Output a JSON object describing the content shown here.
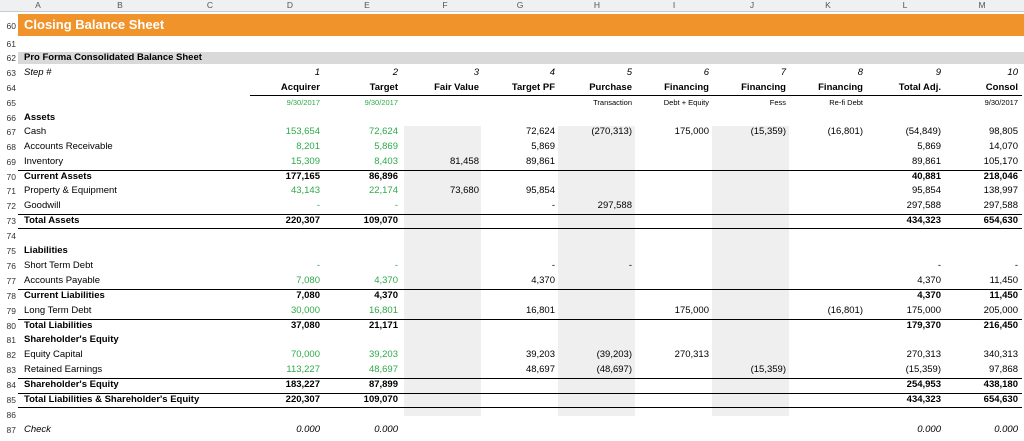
{
  "column_letters": [
    "A",
    "B",
    "C",
    "D",
    "E",
    "F",
    "G",
    "H",
    "I",
    "J",
    "K",
    "L",
    "M"
  ],
  "banner": {
    "title": "Closing Balance Sheet",
    "color": "#f0932b"
  },
  "colors": {
    "input_green": "#2eaa4a",
    "shade_grey": "#efefef",
    "section_band": "#d9d9d9"
  },
  "rows": [
    {
      "n": "60",
      "cells": []
    },
    {
      "n": "61",
      "cells": []
    },
    {
      "n": "62",
      "cells": [
        {
          "c": "A",
          "v": "Pro Forma Consolidated Balance Sheet",
          "cls": "txt bold"
        }
      ]
    },
    {
      "n": "63",
      "cells": [
        {
          "c": "A",
          "v": "Step #",
          "cls": "txt ital"
        },
        {
          "c": "D",
          "v": "1",
          "cls": "num ital"
        },
        {
          "c": "E",
          "v": "2",
          "cls": "num ital"
        },
        {
          "c": "F",
          "v": "3",
          "cls": "num ital"
        },
        {
          "c": "G",
          "v": "4",
          "cls": "num ital"
        },
        {
          "c": "H",
          "v": "5",
          "cls": "num ital"
        },
        {
          "c": "I",
          "v": "6",
          "cls": "num ital"
        },
        {
          "c": "J",
          "v": "7",
          "cls": "num ital"
        },
        {
          "c": "K",
          "v": "8",
          "cls": "num ital"
        },
        {
          "c": "L",
          "v": "9",
          "cls": "num ital"
        },
        {
          "c": "M",
          "v": "10",
          "cls": "num ital"
        }
      ]
    },
    {
      "n": "64",
      "cells": [
        {
          "c": "D",
          "v": "Acquirer",
          "cls": "num bold"
        },
        {
          "c": "E",
          "v": "Target",
          "cls": "num bold"
        },
        {
          "c": "F",
          "v": "Fair Value",
          "cls": "num bold"
        },
        {
          "c": "G",
          "v": "Target PF",
          "cls": "num bold"
        },
        {
          "c": "H",
          "v": "Purchase",
          "cls": "num bold"
        },
        {
          "c": "I",
          "v": "Financing",
          "cls": "num bold"
        },
        {
          "c": "J",
          "v": "Financing",
          "cls": "num bold"
        },
        {
          "c": "K",
          "v": "Financing",
          "cls": "num bold"
        },
        {
          "c": "L",
          "v": "Total Adj.",
          "cls": "num bold"
        },
        {
          "c": "M",
          "v": "Consol",
          "cls": "num bold"
        }
      ]
    },
    {
      "n": "65",
      "cells": [
        {
          "c": "D",
          "v": "9/30/2017",
          "cls": "num small green"
        },
        {
          "c": "E",
          "v": "9/30/2017",
          "cls": "num small green"
        },
        {
          "c": "H",
          "v": "Transaction",
          "cls": "num small"
        },
        {
          "c": "I",
          "v": "Debt + Equity",
          "cls": "num small"
        },
        {
          "c": "J",
          "v": "Fess",
          "cls": "num small"
        },
        {
          "c": "K",
          "v": "Re-fi Debt",
          "cls": "num small"
        },
        {
          "c": "M",
          "v": "9/30/2017",
          "cls": "num small"
        }
      ]
    },
    {
      "n": "66",
      "cells": [
        {
          "c": "A",
          "v": "Assets",
          "cls": "txt bold"
        }
      ]
    },
    {
      "n": "67",
      "cells": [
        {
          "c": "A",
          "v": "Cash",
          "cls": "txt"
        },
        {
          "c": "D",
          "v": "153,654",
          "cls": "num green"
        },
        {
          "c": "E",
          "v": "72,624",
          "cls": "num green"
        },
        {
          "c": "G",
          "v": "72,624",
          "cls": "num"
        },
        {
          "c": "H",
          "v": "(270,313)",
          "cls": "num"
        },
        {
          "c": "I",
          "v": "175,000",
          "cls": "num"
        },
        {
          "c": "J",
          "v": "(15,359)",
          "cls": "num"
        },
        {
          "c": "K",
          "v": "(16,801)",
          "cls": "num"
        },
        {
          "c": "L",
          "v": "(54,849)",
          "cls": "num"
        },
        {
          "c": "M",
          "v": "98,805",
          "cls": "num"
        }
      ]
    },
    {
      "n": "68",
      "cells": [
        {
          "c": "A",
          "v": "Accounts Receivable",
          "cls": "txt"
        },
        {
          "c": "D",
          "v": "8,201",
          "cls": "num green"
        },
        {
          "c": "E",
          "v": "5,869",
          "cls": "num green"
        },
        {
          "c": "G",
          "v": "5,869",
          "cls": "num"
        },
        {
          "c": "L",
          "v": "5,869",
          "cls": "num"
        },
        {
          "c": "M",
          "v": "14,070",
          "cls": "num"
        }
      ]
    },
    {
      "n": "69",
      "cells": [
        {
          "c": "A",
          "v": "Inventory",
          "cls": "txt"
        },
        {
          "c": "D",
          "v": "15,309",
          "cls": "num green"
        },
        {
          "c": "E",
          "v": "8,403",
          "cls": "num green"
        },
        {
          "c": "F",
          "v": "81,458",
          "cls": "num"
        },
        {
          "c": "G",
          "v": "89,861",
          "cls": "num"
        },
        {
          "c": "L",
          "v": "89,861",
          "cls": "num"
        },
        {
          "c": "M",
          "v": "105,170",
          "cls": "num"
        }
      ]
    },
    {
      "n": "70",
      "cells": [
        {
          "c": "A",
          "v": "Current Assets",
          "cls": "txt bold"
        },
        {
          "c": "D",
          "v": "177,165",
          "cls": "num bold"
        },
        {
          "c": "E",
          "v": "86,896",
          "cls": "num bold"
        },
        {
          "c": "L",
          "v": "40,881",
          "cls": "num bold"
        },
        {
          "c": "M",
          "v": "218,046",
          "cls": "num bold"
        }
      ]
    },
    {
      "n": "71",
      "cells": [
        {
          "c": "A",
          "v": "Property & Equipment",
          "cls": "txt"
        },
        {
          "c": "D",
          "v": "43,143",
          "cls": "num green"
        },
        {
          "c": "E",
          "v": "22,174",
          "cls": "num green"
        },
        {
          "c": "F",
          "v": "73,680",
          "cls": "num"
        },
        {
          "c": "G",
          "v": "95,854",
          "cls": "num"
        },
        {
          "c": "L",
          "v": "95,854",
          "cls": "num"
        },
        {
          "c": "M",
          "v": "138,997",
          "cls": "num"
        }
      ]
    },
    {
      "n": "72",
      "cells": [
        {
          "c": "A",
          "v": "Goodwill",
          "cls": "txt"
        },
        {
          "c": "D",
          "v": "-",
          "cls": "num green"
        },
        {
          "c": "E",
          "v": "-",
          "cls": "num green"
        },
        {
          "c": "G",
          "v": "-",
          "cls": "num"
        },
        {
          "c": "H",
          "v": "297,588",
          "cls": "num"
        },
        {
          "c": "L",
          "v": "297,588",
          "cls": "num"
        },
        {
          "c": "M",
          "v": "297,588",
          "cls": "num"
        }
      ]
    },
    {
      "n": "73",
      "cells": [
        {
          "c": "A",
          "v": "Total Assets",
          "cls": "txt bold"
        },
        {
          "c": "D",
          "v": "220,307",
          "cls": "num bold"
        },
        {
          "c": "E",
          "v": "109,070",
          "cls": "num bold"
        },
        {
          "c": "L",
          "v": "434,323",
          "cls": "num bold"
        },
        {
          "c": "M",
          "v": "654,630",
          "cls": "num bold"
        }
      ]
    },
    {
      "n": "74",
      "cells": []
    },
    {
      "n": "75",
      "cells": [
        {
          "c": "A",
          "v": "Liabilities",
          "cls": "txt bold"
        }
      ]
    },
    {
      "n": "76",
      "cells": [
        {
          "c": "A",
          "v": "Short Term Debt",
          "cls": "txt"
        },
        {
          "c": "D",
          "v": "-",
          "cls": "num green"
        },
        {
          "c": "E",
          "v": "-",
          "cls": "num green"
        },
        {
          "c": "G",
          "v": "-",
          "cls": "num"
        },
        {
          "c": "H",
          "v": "-",
          "cls": "num"
        },
        {
          "c": "L",
          "v": "-",
          "cls": "num"
        },
        {
          "c": "M",
          "v": "-",
          "cls": "num"
        }
      ]
    },
    {
      "n": "77",
      "cells": [
        {
          "c": "A",
          "v": "Accounts Payable",
          "cls": "txt"
        },
        {
          "c": "D",
          "v": "7,080",
          "cls": "num green"
        },
        {
          "c": "E",
          "v": "4,370",
          "cls": "num green"
        },
        {
          "c": "G",
          "v": "4,370",
          "cls": "num"
        },
        {
          "c": "L",
          "v": "4,370",
          "cls": "num"
        },
        {
          "c": "M",
          "v": "11,450",
          "cls": "num"
        }
      ]
    },
    {
      "n": "78",
      "cells": [
        {
          "c": "A",
          "v": "Current Liabilities",
          "cls": "txt bold"
        },
        {
          "c": "D",
          "v": "7,080",
          "cls": "num bold"
        },
        {
          "c": "E",
          "v": "4,370",
          "cls": "num bold"
        },
        {
          "c": "L",
          "v": "4,370",
          "cls": "num bold"
        },
        {
          "c": "M",
          "v": "11,450",
          "cls": "num bold"
        }
      ]
    },
    {
      "n": "79",
      "cells": [
        {
          "c": "A",
          "v": "Long Term Debt",
          "cls": "txt"
        },
        {
          "c": "D",
          "v": "30,000",
          "cls": "num green"
        },
        {
          "c": "E",
          "v": "16,801",
          "cls": "num green"
        },
        {
          "c": "G",
          "v": "16,801",
          "cls": "num"
        },
        {
          "c": "I",
          "v": "175,000",
          "cls": "num"
        },
        {
          "c": "K",
          "v": "(16,801)",
          "cls": "num"
        },
        {
          "c": "L",
          "v": "175,000",
          "cls": "num"
        },
        {
          "c": "M",
          "v": "205,000",
          "cls": "num"
        }
      ]
    },
    {
      "n": "80",
      "cells": [
        {
          "c": "A",
          "v": "Total Liabilities",
          "cls": "txt bold"
        },
        {
          "c": "D",
          "v": "37,080",
          "cls": "num bold"
        },
        {
          "c": "E",
          "v": "21,171",
          "cls": "num bold"
        },
        {
          "c": "L",
          "v": "179,370",
          "cls": "num bold"
        },
        {
          "c": "M",
          "v": "216,450",
          "cls": "num bold"
        }
      ]
    },
    {
      "n": "81",
      "cells": [
        {
          "c": "A",
          "v": "Shareholder's Equity",
          "cls": "txt bold"
        }
      ]
    },
    {
      "n": "82",
      "cells": [
        {
          "c": "A",
          "v": "Equity Capital",
          "cls": "txt"
        },
        {
          "c": "D",
          "v": "70,000",
          "cls": "num green"
        },
        {
          "c": "E",
          "v": "39,203",
          "cls": "num green"
        },
        {
          "c": "G",
          "v": "39,203",
          "cls": "num"
        },
        {
          "c": "H",
          "v": "(39,203)",
          "cls": "num"
        },
        {
          "c": "I",
          "v": "270,313",
          "cls": "num"
        },
        {
          "c": "L",
          "v": "270,313",
          "cls": "num"
        },
        {
          "c": "M",
          "v": "340,313",
          "cls": "num"
        }
      ]
    },
    {
      "n": "83",
      "cells": [
        {
          "c": "A",
          "v": "Retained Earnings",
          "cls": "txt"
        },
        {
          "c": "D",
          "v": "113,227",
          "cls": "num green"
        },
        {
          "c": "E",
          "v": "48,697",
          "cls": "num green"
        },
        {
          "c": "G",
          "v": "48,697",
          "cls": "num"
        },
        {
          "c": "H",
          "v": "(48,697)",
          "cls": "num"
        },
        {
          "c": "J",
          "v": "(15,359)",
          "cls": "num"
        },
        {
          "c": "L",
          "v": "(15,359)",
          "cls": "num"
        },
        {
          "c": "M",
          "v": "97,868",
          "cls": "num"
        }
      ]
    },
    {
      "n": "84",
      "cells": [
        {
          "c": "A",
          "v": "Shareholder's Equity",
          "cls": "txt bold"
        },
        {
          "c": "D",
          "v": "183,227",
          "cls": "num bold"
        },
        {
          "c": "E",
          "v": "87,899",
          "cls": "num bold"
        },
        {
          "c": "L",
          "v": "254,953",
          "cls": "num bold"
        },
        {
          "c": "M",
          "v": "438,180",
          "cls": "num bold"
        }
      ]
    },
    {
      "n": "85",
      "cells": [
        {
          "c": "A",
          "v": "Total Liabilities & Shareholder's Equity",
          "cls": "txt bold"
        },
        {
          "c": "D",
          "v": "220,307",
          "cls": "num bold"
        },
        {
          "c": "E",
          "v": "109,070",
          "cls": "num bold"
        },
        {
          "c": "L",
          "v": "434,323",
          "cls": "num bold"
        },
        {
          "c": "M",
          "v": "654,630",
          "cls": "num bold"
        }
      ]
    },
    {
      "n": "86",
      "cells": []
    },
    {
      "n": "87",
      "cells": [
        {
          "c": "A",
          "v": "Check",
          "cls": "txt ital"
        },
        {
          "c": "D",
          "v": "0.000",
          "cls": "num ital"
        },
        {
          "c": "E",
          "v": "0.000",
          "cls": "num ital"
        },
        {
          "c": "L",
          "v": "0.000",
          "cls": "num ital"
        },
        {
          "c": "M",
          "v": "0.000",
          "cls": "num ital"
        }
      ]
    }
  ]
}
